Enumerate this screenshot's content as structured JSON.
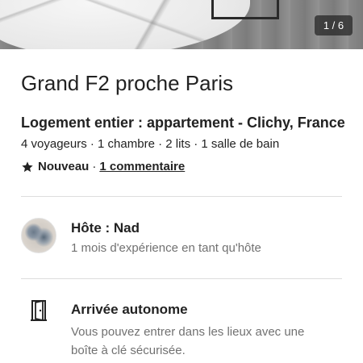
{
  "photo": {
    "counter": "1 / 6"
  },
  "listing": {
    "title": "Grand F2 proche Paris",
    "subtitle": "Logement entier : appartement - Clichy, France",
    "details": "4 voyageurs · 1 chambre · 2 lits · 1 salle de bain",
    "badge": "Nouveau",
    "separator": "·",
    "reviews_link": "1 commentaire"
  },
  "host": {
    "title": "Hôte : Nad",
    "subtitle": "1 mois d'expérience en tant qu'hôte"
  },
  "checkin": {
    "icon": "door-icon",
    "title": "Arrivée autonome",
    "description": "Vous pouvez entrer dans les lieux avec une boîte à clé sécurisée."
  }
}
